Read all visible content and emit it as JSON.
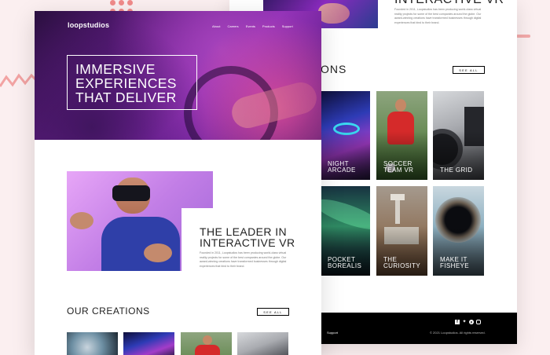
{
  "brand": {
    "logo": "loopstudios"
  },
  "nav": [
    "About",
    "Careers",
    "Events",
    "Products",
    "Support"
  ],
  "hero": {
    "title": "IMMERSIVE EXPERIENCES THAT DELIVER"
  },
  "leader": {
    "title": "THE LEADER IN INTERACTIVE VR",
    "text": "Founded in 2011, Loopstudios has been producing world-class virtual reality projects for some of the best companies around the globe. Our award-winning creations have transformed businesses through digital experiences that bind to their brand."
  },
  "back_intro": {
    "heading": "INTERACTIVE VR",
    "text": "Founded in 2011, Loopstudios has been producing world-class virtual reality projects for some of the best companies around the globe. Our award-winning creations have transformed businesses through digital experiences that bind to their brand."
  },
  "creations": {
    "front_title": "OUR CREATIONS",
    "back_title": "ONS",
    "see_all": "SEE ALL",
    "items": [
      {
        "label": "NIGHT ARCADE",
        "color": "#3a2f8f"
      },
      {
        "label": "SOCCER TEAM VR",
        "color": "#4e7a3e"
      },
      {
        "label": "THE GRID",
        "color": "#8a8c92"
      },
      {
        "label": "POCKET BOREALIS",
        "color": "#2f7a58"
      },
      {
        "label": "THE CURIOSITY",
        "color": "#9c7e5e"
      },
      {
        "label": "MAKE IT FISHEYE",
        "color": "#6d8fa3"
      }
    ]
  },
  "footer": {
    "link": "Support",
    "copyright": "© 2021 Loopstudios. All rights reserved.",
    "social_icons": [
      "facebook-icon",
      "twitter-icon",
      "pinterest-icon",
      "instagram-icon"
    ]
  }
}
